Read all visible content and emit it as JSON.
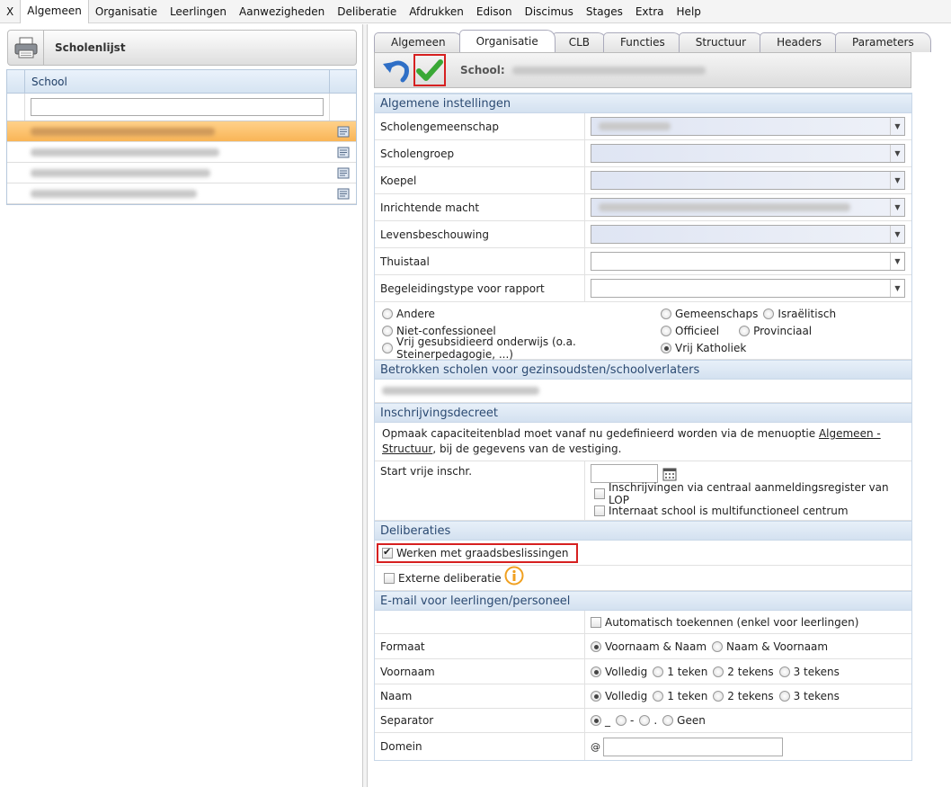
{
  "menu": [
    "X",
    "Algemeen",
    "Organisatie",
    "Leerlingen",
    "Aanwezigheden",
    "Deliberatie",
    "Afdrukken",
    "Edison",
    "Discimus",
    "Stages",
    "Extra",
    "Help"
  ],
  "left": {
    "title": "Scholenlijst",
    "column_header": "School"
  },
  "tabs": [
    "Algemeen",
    "Organisatie",
    "CLB",
    "Functies",
    "Structuur",
    "Headers",
    "Parameters"
  ],
  "toolbar": {
    "school_label": "School:"
  },
  "sections": {
    "algemeen": "Algemene instellingen",
    "betrokken": "Betrokken scholen voor gezinsoudsten/schoolverlaters",
    "inschrijving": "Inschrijvingsdecreet",
    "deliberaties": "Deliberaties",
    "email": "E-mail voor leerlingen/personeel"
  },
  "fields": {
    "scholengemeenschap": "Scholengemeenschap",
    "scholengroep": "Scholengroep",
    "koepel": "Koepel",
    "inrichtende_macht": "Inrichtende macht",
    "levensbeschouwing": "Levensbeschouwing",
    "thuistaal": "Thuistaal",
    "begeleidingstype": "Begeleidingstype voor rapport"
  },
  "radio_net": {
    "andere": "Andere",
    "niet_confessioneel": "Niet-confessioneel",
    "vrij_gesubsidieerd": "Vrij gesubsidieerd onderwijs (o.a. Steinerpedagogie, ...)",
    "gemeenschaps": "Gemeenschaps",
    "israelitisch": "Israëlitisch",
    "officieel": "Officieel",
    "provinciaal": "Provinciaal",
    "vrij_katholiek": "Vrij Katholiek"
  },
  "inschrijving": {
    "note_prefix": "Opmaak capaciteitenblad moet vanaf nu gedefinieerd worden via de menuoptie ",
    "note_link": "Algemeen - Structuur",
    "note_suffix": ", bij de gegevens van de vestiging.",
    "start_label": "Start vrije inschr.",
    "lop_label": "Inschrijvingen via centraal aanmeldingsregister van LOP",
    "internaat_label": "Internaat school is multifunctioneel centrum"
  },
  "deliberaties": {
    "graad_label": "Werken met graadsbeslissingen",
    "extern_label": "Externe deliberatie"
  },
  "email": {
    "auto_label": "Automatisch toekennen (enkel voor leerlingen)",
    "formaat_label": "Formaat",
    "formaat_opt1": "Voornaam & Naam",
    "formaat_opt2": "Naam & Voornaam",
    "voornaam_label": "Voornaam",
    "naam_label": "Naam",
    "opt_volledig": "Volledig",
    "opt_1": "1 teken",
    "opt_2": "2 tekens",
    "opt_3": "3 tekens",
    "separator_label": "Separator",
    "sep_1": "_",
    "sep_2": "-",
    "sep_3": ".",
    "sep_geen": "Geen",
    "domein_label": "Domein",
    "at": "@"
  }
}
